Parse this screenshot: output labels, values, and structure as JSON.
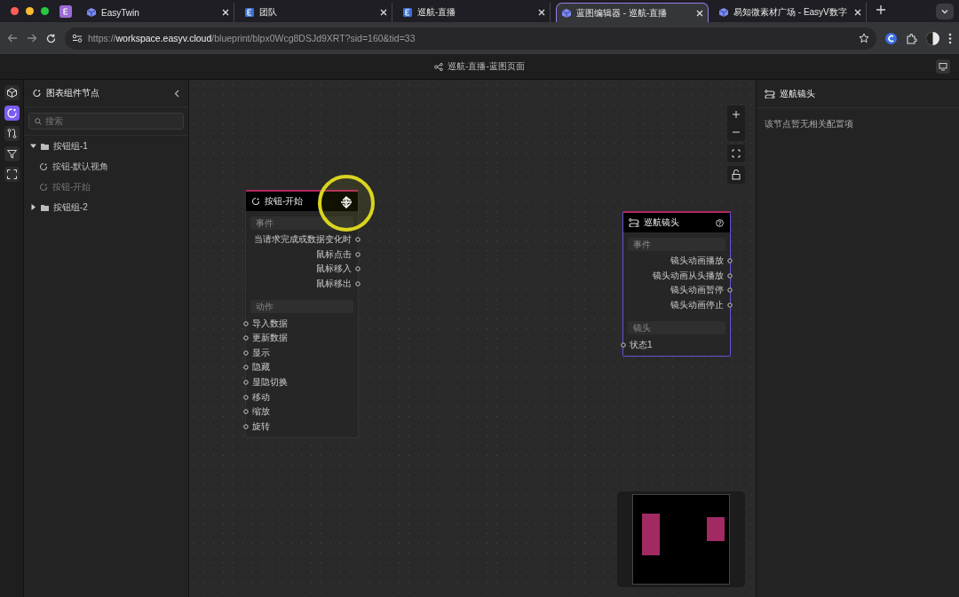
{
  "browser": {
    "tabs": [
      {
        "title": "EasyTwin",
        "selected": false
      },
      {
        "title": "团队",
        "selected": false
      },
      {
        "title": "巡航-直播",
        "selected": false
      },
      {
        "title": "蓝图编辑器 - 巡航-直播",
        "selected": true
      },
      {
        "title": "易知微素材广场 - EasyV数字",
        "selected": false
      }
    ],
    "url": {
      "scheme": "https://",
      "host": "workspace.easyv.cloud",
      "path": "/blueprint/blpx0Wcg8DSJd9XRT?sid=160&tid=33"
    }
  },
  "header": {
    "breadcrumb": "巡航-直播-蓝图页面"
  },
  "rail": {
    "items": [
      {
        "selected": false
      },
      {
        "selected": true
      },
      {
        "selected": false
      },
      {
        "selected": false
      },
      {
        "selected": false
      }
    ]
  },
  "sidebar": {
    "title": "图表组件节点",
    "search": {
      "placeholder": "搜索"
    },
    "tree": [
      {
        "label": "按钮组-1",
        "expanded": true,
        "children": [
          {
            "label": "按钮-默认视角",
            "dimmed": false
          },
          {
            "label": "按钮-开始",
            "dimmed": true
          }
        ]
      },
      {
        "label": "按钮组-2",
        "expanded": false
      }
    ]
  },
  "canvas": {
    "nodes": [
      {
        "title": "按钮-开始",
        "selected": false,
        "sections": [
          {
            "title": "事件",
            "kind": "output",
            "ports": [
              "当请求完成或数据变化时",
              "鼠标点击",
              "鼠标移入",
              "鼠标移出"
            ]
          },
          {
            "title": "动作",
            "kind": "input",
            "ports": [
              "导入数据",
              "更新数据",
              "显示",
              "隐藏",
              "显隐切换",
              "移动",
              "缩放",
              "旋转"
            ]
          }
        ]
      },
      {
        "title": "巡航镜头",
        "selected": true,
        "sections": [
          {
            "title": "事件",
            "kind": "output",
            "ports": [
              "镜头动画播放",
              "镜头动画从头播放",
              "镜头动画暂停",
              "镜头动画停止"
            ]
          },
          {
            "title": "镜头",
            "kind": "input",
            "ports": [
              "状态1"
            ]
          }
        ]
      }
    ]
  },
  "properties": {
    "title": "巡航镜头",
    "message": "该节点暂无相关配置项"
  }
}
